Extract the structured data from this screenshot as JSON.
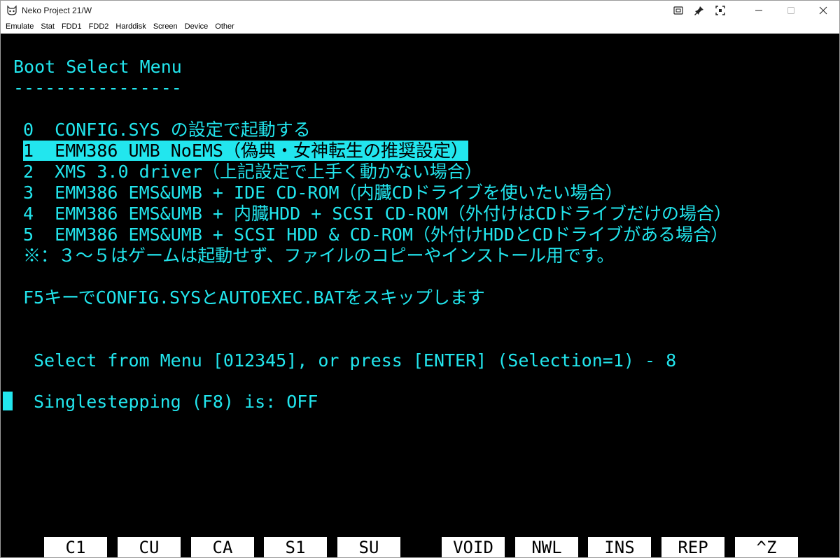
{
  "window": {
    "title": "Neko Project 21/W"
  },
  "menubar": {
    "items": [
      "Emulate",
      "Stat",
      "FDD1",
      "FDD2",
      "Harddisk",
      "Screen",
      "Device",
      "Other"
    ]
  },
  "screen": {
    "header": "Boot Select Menu",
    "underline": "----------------",
    "menu_lines": [
      "0  CONFIG.SYS の設定で起動する",
      "1  EMM386 UMB NoEMS（偽典・女神転生の推奨設定）",
      "2  XMS 3.0 driver（上記設定で上手く動かない場合）",
      "3  EMM386 EMS&UMB + IDE CD-ROM（内臓CDドライブを使いたい場合）",
      "4  EMM386 EMS&UMB + 内臓HDD + SCSI CD-ROM（外付けはCDドライブだけの場合）",
      "5  EMM386 EMS&UMB + SCSI HDD & CD-ROM（外付けHDDとCDドライブがある場合）",
      "※：３～５はゲームは起動せず、ファイルのコピーやインストール用です。"
    ],
    "selected_index": 1,
    "skip_note": "F5キーでCONFIG.SYSとAUTOEXEC.BATをスキップします",
    "prompt": "Select from Menu [012345], or press [ENTER] (Selection=1) - 8",
    "singlestep": "Singlestepping (F8) is: OFF"
  },
  "fkeys": [
    "C1",
    "CU",
    "CA",
    "S1",
    "SU",
    "VOID",
    "NWL",
    "INS",
    "REP",
    "^Z"
  ],
  "colors": {
    "text": "#22e6ee",
    "background": "#000000"
  }
}
